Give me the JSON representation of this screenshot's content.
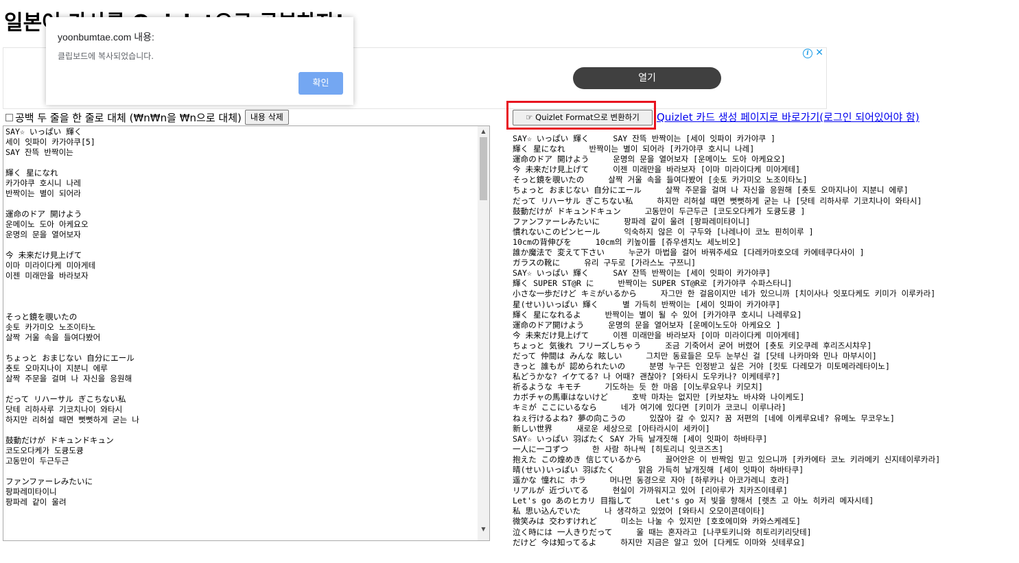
{
  "page": {
    "title": "일본어 가사를 Quizlet으로 공부하자!"
  },
  "ad": {
    "info_icon": "info-icon",
    "close_icon": "close-icon",
    "close_symbol": "✕",
    "info_symbol": "i",
    "open_label": "열기"
  },
  "alert": {
    "title": "yoonbumtae.com 내용:",
    "message": "클립보드에 복사되었습니다.",
    "ok_label": "확인"
  },
  "toolbar": {
    "option_label": "공백 두 줄을 한 줄로 대체 (₩n₩n을 ₩n으로 대체)",
    "clear_label": "내용 삭제",
    "convert_label": "☞ Quizlet Format으로 변환하기",
    "link_label": "Quizlet 카드 생성 페이지로 바로가기(로그인 되어있어야 함)"
  },
  "input": {
    "text": "SAY☆ いっぱい 輝く\n세이 잇파이 카가야쿠[5]\nSAY 잔뜩 반짝이는\n\n輝く 星になれ\n카가야쿠 호시니 나레\n반짝이는 별이 되어라\n\n運命のドア 開けよう\n운메이노 도아 아케요오\n운명의 문을 열어보자\n\n今 未来だけ見上げて\n이마 미라이다케 미아게테\n이젠 미래만을 바라보자\n\n\n\nそっと鏡を覗いたの\n솟토 카가미오 노조이타노\n살짝 거울 속을 들여다봤어\n\nちょっと おまじない 自分にエール\n춋토 오마지나이 지분니 에루\n살짝 주문을 걸며 나 자신을 응원해\n\nだって リハーサル ぎこちない私\n닷테 리하사루 기코치나이 와타시\n하지만 리허설 때면 뻣뻣하게 굳는 나\n\n鼓動だけが ドキュンドキュン\n코도오다케가 도큥도큥\n고동만이 두근두근\n\nファンファーレみたいに\n팡파레미타이니\n팡파레 같이 울려\n"
  },
  "output": {
    "lines": [
      "SAY☆ いっぱい 輝く\tSAY 잔뜩 반짝이는 [세이 잇파이 카가야쿠 ]",
      "輝く 星になれ\t반짝이는 별이 되어라 [카가야쿠 호시니 나레]",
      "運命のドア 開けよう\t운명의 문을 열어보자 [운메이노 도아 아케요오]",
      "今 未来だけ見上げて\t이젠 미래만을 바라보자 [이마 미라이다케 미아게테]",
      "そっと鏡を覗いたの\t살짝 거울 속을 들여다봤어 [솟토 카가미오 노조이타노]",
      "ちょっと おまじない 自分にエール\t살짝 주문을 걸며 나 자신을 응원해 [춋토 오마지나이 지분니 에루]",
      "だって リハーサル ぎこちない私\t하지만 리허설 때면 뻣뻣하게 굳는 나 [닷테 리하사루 기코치나이 와타시]",
      "鼓動だけが ドキュンドキュン\t고동만이 두근두근 [코도오다케가 도큥도큥 ]",
      "ファンファーレみたいに\t팡파레 같이 울려 [팡파레미타이니]",
      "慣れないこのピンヒール\t익숙하지 않은 이 구두와 [나레나이 코노 핀히이루 ]",
      "10cmの背伸びを\t10cm의 키높이를 [쥬우센치노 세노비오]",
      "誰か魔法で 変えて下さい\t누군가 마법을 걸어 바꿔주세요 [다레카마호오데 카에테쿠다사이 ]",
      "ガラスの靴に\t유리 구두로 [가라스노 구쯔니]",
      "SAY☆ いっぱい 輝く\tSAY 잔뜩 반짝이는 [세이 잇파이 카가야쿠]",
      "輝く SUPER ST@R に\t반짝이는 SUPER ST@R로 [카가야쿠 수파스타니]",
      "小さな一歩だけど キミがいるから\t자그만 한 걸음이지만 네가 있으니까 [치이사나 잇포다케도 키미가 이루카라]",
      "星(せい)いっぱい 輝く\t별 가득히 반짝이는 [세이 잇파이 카가야쿠]",
      "輝く 星になれるよ\t반짝이는 별이 될 수 있어 [카가야쿠 호시니 나레루요]",
      "運命のドア開けよう\t운명의 문을 열어보자 [운메이노도아 아케요오 ]",
      "今 未来だけ見上げて\t이젠 미래만을 바라보자 [이마 미라이다케 미아게테]",
      "ちょっと 気後れ フリーズしちゃう\t조금 기죽어서 굳어 버렸어 [춋토 키오쿠레 후리즈시챠우]",
      "だって 仲間は みんな 眩しい\t그치만 동료들은 모두 눈부신 걸 [닷테 나카마와 민나 마부시이]",
      "きっと 誰もが 認められたいの\t분명 누구든 인정받고 싶은 거야 [킷토 다레모가 미토메라레타이노]",
      "私どうかな? イケてる? 나 어때? 괜찮아? [와타시 도우카나? 이케테루?]",
      "祈るような キモチ\t기도하는 듯 한 마음 [이노루요우나 키모치]",
      "カボチャの馬車はないけど\t호박 마차는 없지만 [카보챠노 바샤와 나이케도]",
      "キミが ここにいるなら\t네가 여기에 있다면 [키미가 코코니 이루나라]",
      "ねぇ行けるよね? 夢の向こうの\t있잖아 갈 수 있지? 꿈 저편의 [네에 이케루요네? 유메노 무코우노]",
      "新しい世界\t새로운 세상으로 [아타라시이 세카이]",
      "SAY☆ いっぱい 羽ばたく SAY 가득 날개짓해 [세이 잇파이 하바타쿠]",
      "一人に一コずつ\t한 사람 하나씩 [히토리니 잇코즈츠]",
      "抱えた この煌めき 信じているから\t끌어안은 이 반짝임 믿고 있으니까 [카카에타 코노 키라메키 신지테이루카라]",
      "晴(せい)いっぱい 羽ばたく\t맑음 가득히 날개짓해 [세이 잇파이 하바타쿠]",
      "遥かな 憧れに ホラ\t머나먼 동경으로 자아 [하루카나 아코가레니 호라]",
      "リアルが 近づいてる\t현실이 가까워지고 있어 [리아루가 치카즈이테루]",
      "Let's go あのヒカリ 目指して\tLet's go 저 빛을 향해서 [렛츠 고 아노 히카리 메자시테]",
      "私 思い込んでいた\t나 생각하고 있었어 [와타시 오모이콘데이타]",
      "微笑みは 交わすけれど\t미소는 나눌 수 있지만 [호호에미와 카와스케레도]",
      "泣く時には 一人きりだって\t울 때는 혼자라고 [나쿠토키니와 히토리키리닷테]",
      "だけど 今は知ってるよ\t하지만 지금은 알고 있어 [다케도 이마와 싯테루요]"
    ]
  }
}
